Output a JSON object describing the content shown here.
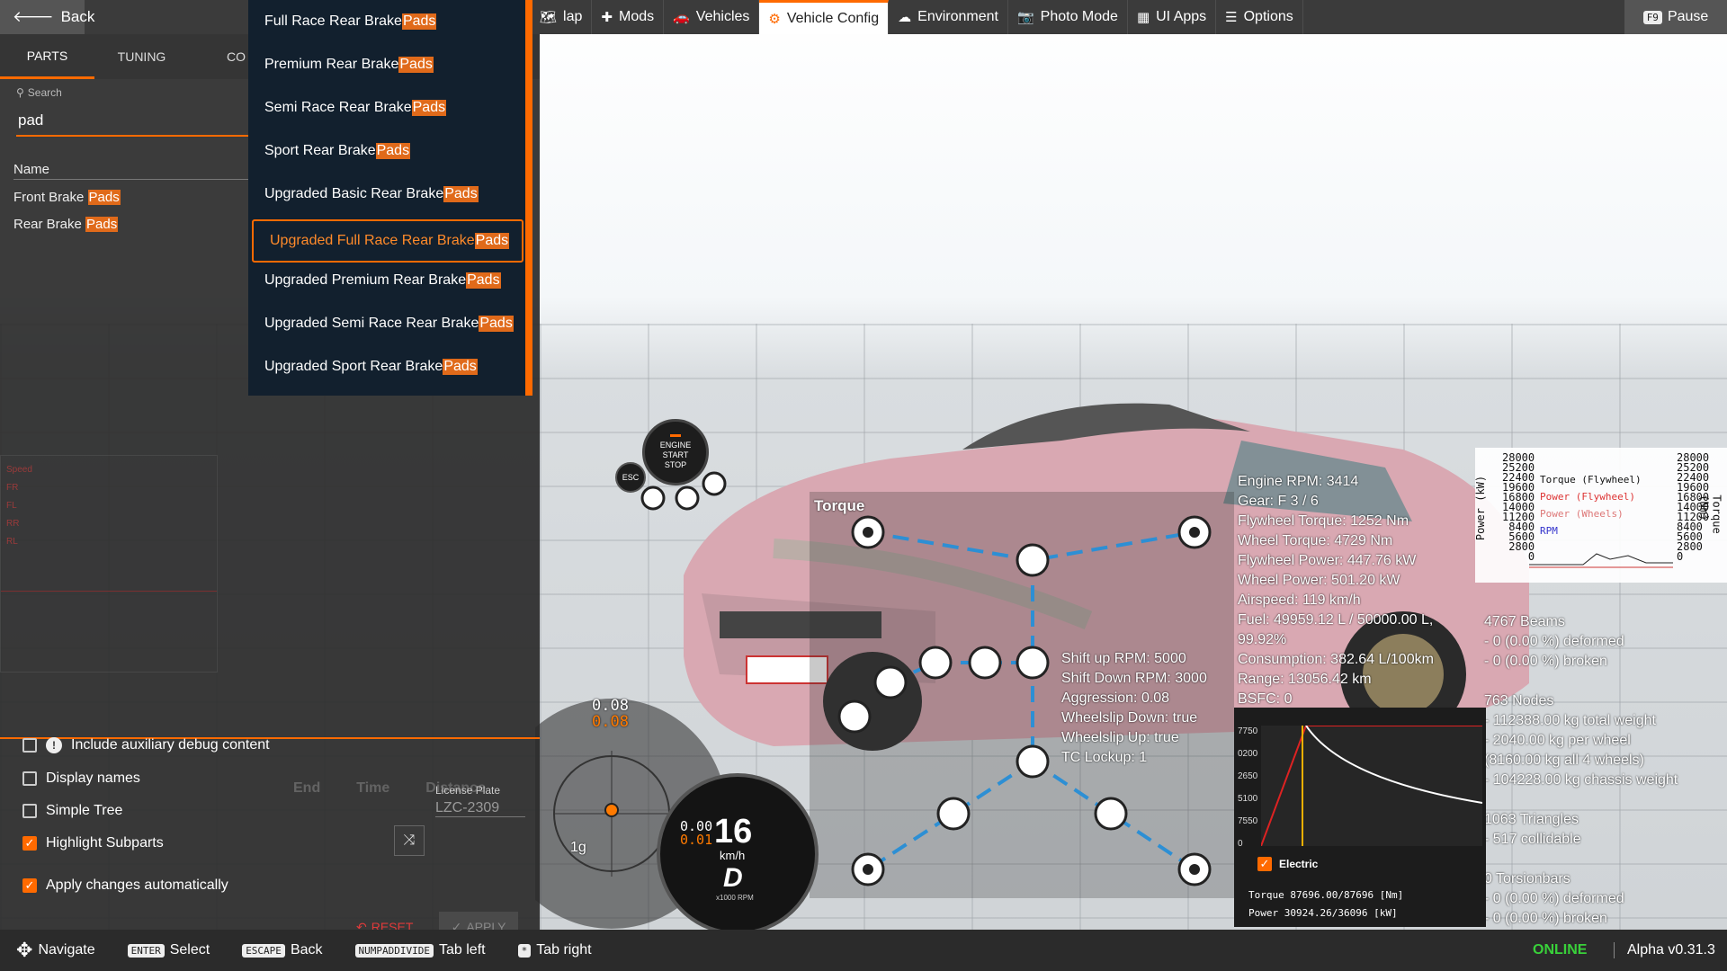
{
  "topbar": {
    "back_label": "Back",
    "nav": [
      {
        "label": "lap",
        "icon": "map-icon"
      },
      {
        "label": "Mods",
        "icon": "puzzle-icon"
      },
      {
        "label": "Vehicles",
        "icon": "car-icon"
      },
      {
        "label": "Vehicle Config",
        "icon": "engine-icon",
        "active": true
      },
      {
        "label": "Environment",
        "icon": "weather-icon"
      },
      {
        "label": "Photo Mode",
        "icon": "camera-icon"
      },
      {
        "label": "UI Apps",
        "icon": "apps-icon"
      },
      {
        "label": "Options",
        "icon": "sliders-icon"
      }
    ],
    "pause_key": "F9",
    "pause_label": "Pause"
  },
  "leftpanel": {
    "tabs": [
      "PARTS",
      "TUNING",
      "CO"
    ],
    "search_label": "Search",
    "search_value": "pad",
    "name_header": "Name",
    "parts": [
      {
        "pre": "Front Brake ",
        "hl": "Pads"
      },
      {
        "pre": "Rear Brake ",
        "hl": "Pads"
      }
    ],
    "graph_labels": [
      "Speed",
      "FR",
      "FL",
      "RR",
      "RL"
    ],
    "faded_columns": [
      "End",
      "Time",
      "Distance"
    ],
    "options": [
      {
        "label": "Include auxiliary debug content",
        "checked": false,
        "info": true
      },
      {
        "label": "Display names",
        "checked": false
      },
      {
        "label": "Simple Tree",
        "checked": false
      },
      {
        "label": "Highlight Subparts",
        "checked": true
      },
      {
        "label": "Apply changes automatically",
        "checked": true
      }
    ],
    "license_label": "License Plate",
    "license_value": "LZC-2309",
    "reset_label": "RESET",
    "apply_label": "APPLY"
  },
  "dropdown": [
    {
      "pre": "Full Race Rear Brake",
      "hl": "Pads"
    },
    {
      "pre": "Premium Rear Brake",
      "hl": "Pads"
    },
    {
      "pre": "Semi Race Rear Brake",
      "hl": "Pads"
    },
    {
      "pre": "Sport Rear Brake",
      "hl": "Pads"
    },
    {
      "pre": "Upgraded Basic Rear Brake",
      "hl": "Pads"
    },
    {
      "pre": "Upgraded Full Race Rear Brake",
      "hl": "Pads",
      "selected": true
    },
    {
      "pre": "Upgraded Premium Rear Brake",
      "hl": "Pads"
    },
    {
      "pre": "Upgraded Semi Race Rear Brake",
      "hl": "Pads"
    },
    {
      "pre": "Upgraded Sport Rear Brake",
      "hl": "Pads"
    }
  ],
  "debug": {
    "torque_title": "Torque",
    "shift": [
      "Shift up RPM: 5000",
      "Shift Down RPM: 3000",
      "Aggression: 0.08",
      "Wheelslip Down: true",
      "Wheelslip Up: true",
      "TC Lockup: 1"
    ],
    "engine": [
      "Engine RPM: 3414",
      "Gear: F 3 / 6",
      "Flywheel Torque: 1252 Nm",
      "Wheel Torque: 4729 Nm",
      "Flywheel Power: 447.76 kW",
      "Wheel Power: 501.20 kW",
      "Airspeed: 119 km/h",
      "Fuel: 49959.12 L / 50000.00 L,",
      "99.92%",
      "Consumption: 382.64 L/100km",
      "Range: 13056.42 km",
      "BSFC: 0"
    ],
    "beams": [
      "4767 Beams",
      "- 0 (0.00 %) deformed",
      "- 0 (0.00 %) broken",
      "",
      "763 Nodes",
      "- 112388.00 kg total weight",
      "- 2040.00 kg per wheel",
      "(8160.00 kg all 4 wheels)",
      "- 104228.00 kg chassis weight",
      "",
      "1063 Triangles",
      "- 517 collidable",
      "",
      "0 Torsionbars",
      "- 0 (0.00 %) deformed",
      "- 0 (0.00 %) broken"
    ],
    "powergraph": {
      "left_ticks": [
        "28000",
        "25200",
        "22400",
        "19600",
        "16800",
        "14000",
        "11200",
        "8400",
        "5600",
        "2800",
        "0"
      ],
      "right_ticks": [
        "28000",
        "25200",
        "22400",
        "19600",
        "16800",
        "14000",
        "11200",
        "8400",
        "5600",
        "2800",
        "0"
      ],
      "left_axis": "Power (kW)",
      "right_axis": "Torque (Nm)",
      "legend": [
        "Torque (Flywheel)",
        "Power (Flywheel)",
        "Power (Wheels)",
        "RPM"
      ]
    },
    "torque_graph": {
      "y_ticks": [
        "7750",
        "0200",
        "2650",
        "5100",
        "7550",
        "0"
      ],
      "electric_label": "Electric",
      "legend_torque": "Torque 87696.00/87696 [Nm]",
      "legend_power": "Power  30924.26/36096 [kW]"
    }
  },
  "hud": {
    "g_top": "0.08",
    "g_top2": "0.08",
    "g_label": "1g",
    "speed": "16",
    "speed_unit": "km/h",
    "gear": "D",
    "rpm_unit": "x1000 RPM",
    "engine_button": [
      "ENGINE",
      "START",
      "STOP"
    ],
    "esc": "ESC",
    "speedo_small_top": "0.00",
    "speedo_small_bottom": "0.01"
  },
  "statusbar": {
    "hints": [
      {
        "key": "",
        "icon": "dpad-icon",
        "label": "Navigate"
      },
      {
        "key": "ENTER",
        "label": "Select"
      },
      {
        "key": "ESCAPE",
        "label": "Back"
      },
      {
        "key": "NUMPADDIVIDE",
        "label": "Tab left"
      },
      {
        "key": "*",
        "label": "Tab right"
      }
    ],
    "online": "ONLINE",
    "version": "Alpha v0.31.3"
  },
  "colors": {
    "accent": "#ff6a00",
    "online": "#39d13a",
    "dropdown_bg": "#12202e"
  }
}
